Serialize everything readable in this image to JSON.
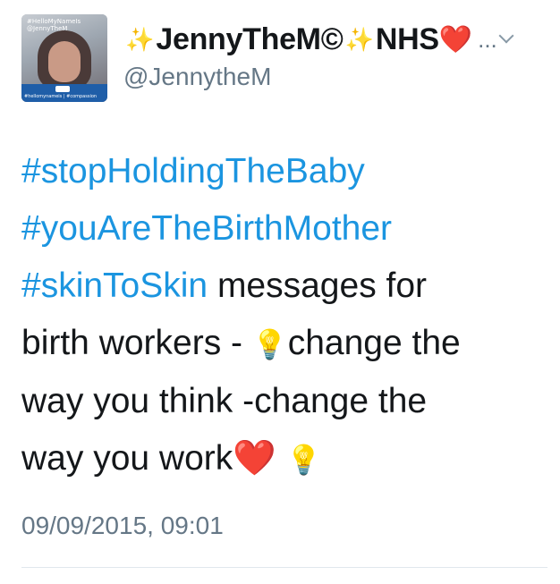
{
  "profile": {
    "avatar_caption_line1": "#HelloMyNameIs",
    "avatar_caption_line2": "@JennyTheM",
    "avatar_band_text": "#hellomynameis | #compassion",
    "display_name_prefix_emoji": "✨",
    "display_name": "JennyTheM©",
    "display_name_mid_emoji": "✨",
    "display_name_suffix": "NHS",
    "display_name_heart": "❤️",
    "more_label": "...",
    "handle": "@JennytheM"
  },
  "tweet": {
    "line1_tag": "#stopHoldingTheBaby",
    "line2_tag": "#youAreTheBirthMother",
    "line3_tag": "#skinToSkin",
    "line3_text": " messages for",
    "line4_text_a": "birth workers - ",
    "line4_bulb": "💡",
    "line4_text_b": "change the",
    "line5_text": "way you think -change the",
    "line6_text": "way you work",
    "line6_heart": "❤️",
    "line6_bulb": "💡"
  },
  "meta": {
    "timestamp": "09/09/2015, 09:01"
  },
  "colors": {
    "hashtag": "#1b95e0",
    "secondary_text": "#657786",
    "heart": "#e0245e"
  },
  "icons": {
    "menu": "chevron-down-icon"
  }
}
